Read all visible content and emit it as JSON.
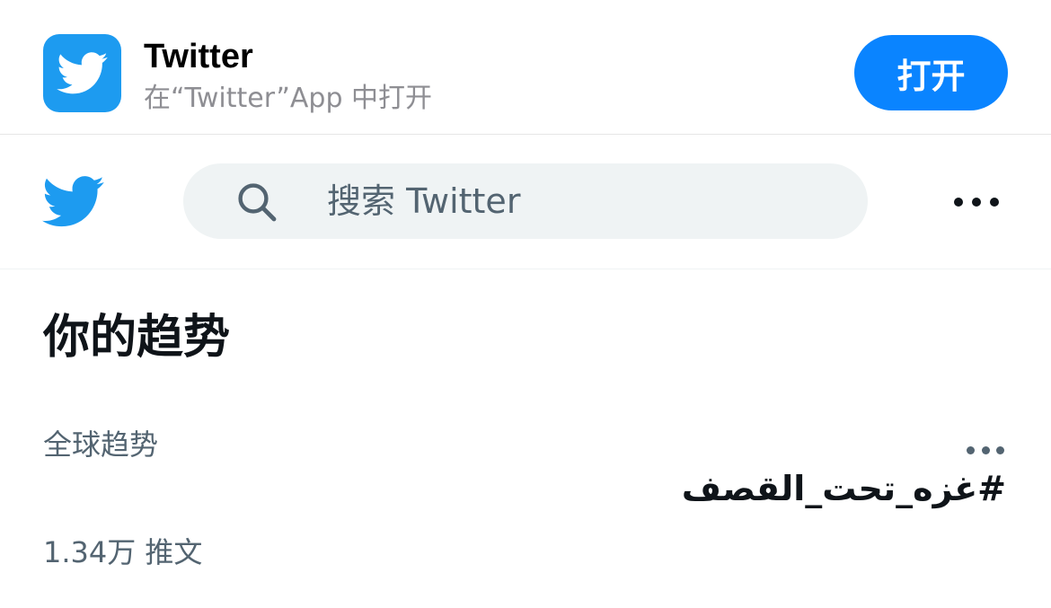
{
  "app_banner": {
    "app_name": "Twitter",
    "subtitle": "在“Twitter”App 中打开",
    "open_label": "打开",
    "icon": "twitter-bird-icon",
    "accent": "#0a84ff"
  },
  "header": {
    "logo_icon": "twitter-bird-icon",
    "search_placeholder": "搜索 Twitter",
    "search_icon": "search-icon",
    "more_icon": "more-horizontal-icon",
    "brand": "#1d9bf0"
  },
  "trends": {
    "title": "你的趋势",
    "items": [
      {
        "context": "全球趋势",
        "name": "#غزه_تحت_القصف",
        "count": "1.34万 推文"
      }
    ]
  }
}
